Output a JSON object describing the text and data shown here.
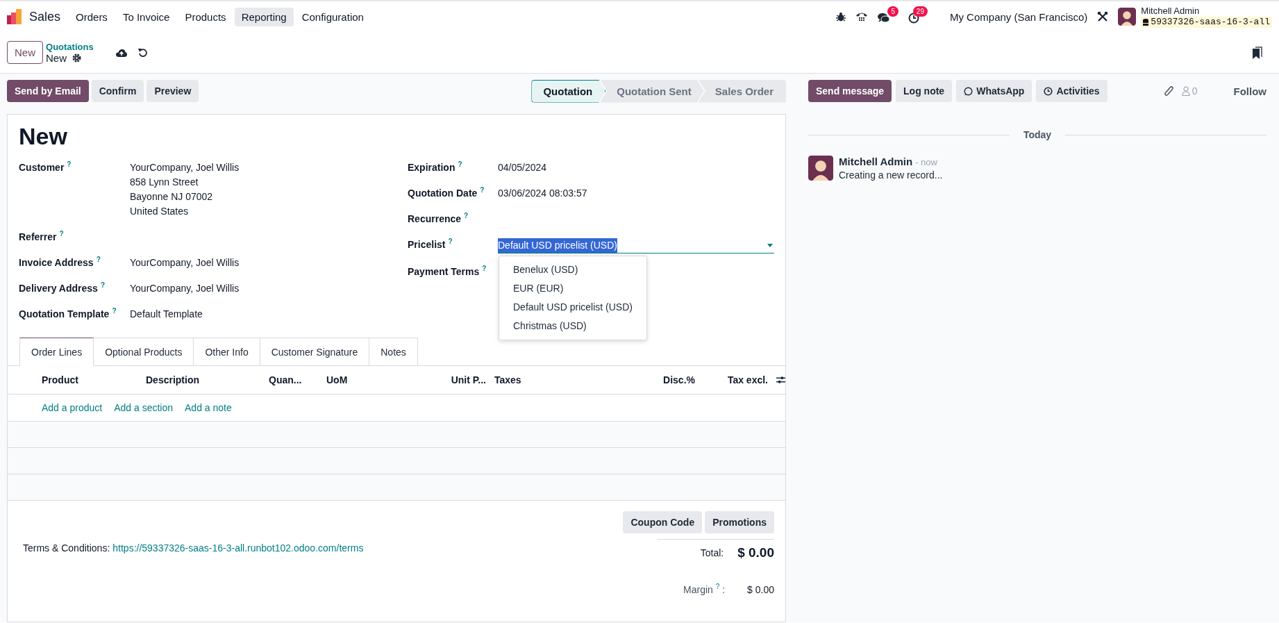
{
  "navbar": {
    "app_name": "Sales",
    "menu": [
      {
        "label": "Orders",
        "selected": false
      },
      {
        "label": "To Invoice",
        "selected": false
      },
      {
        "label": "Products",
        "selected": false
      },
      {
        "label": "Reporting",
        "selected": true
      },
      {
        "label": "Configuration",
        "selected": false
      }
    ],
    "messages_badge": "5",
    "activities_badge": "29",
    "company": "My Company (San Francisco)",
    "user_name": "Mitchell Admin",
    "database": "59337326-saas-16-3-all"
  },
  "control_panel": {
    "new_button": "New",
    "breadcrumb": "Quotations",
    "record_name": "New"
  },
  "actions": [
    {
      "label": "Send by Email",
      "kind": "primary"
    },
    {
      "label": "Confirm",
      "kind": "secondary"
    },
    {
      "label": "Preview",
      "kind": "secondary"
    }
  ],
  "stages": [
    {
      "label": "Quotation",
      "selected": true
    },
    {
      "label": "Quotation Sent",
      "selected": false
    },
    {
      "label": "Sales Order",
      "selected": false
    }
  ],
  "form": {
    "title": "New",
    "left_fields": [
      {
        "label": "Customer",
        "help": "?",
        "values": [
          "YourCompany, Joel Willis",
          "858 Lynn Street",
          "Bayonne NJ 07002",
          "United States"
        ]
      },
      {
        "label": "Referrer",
        "help": "?"
      },
      {
        "label": "Invoice Address",
        "help": "?",
        "values": [
          "YourCompany, Joel Willis"
        ]
      },
      {
        "label": "Delivery Address",
        "help": "?",
        "values": [
          "YourCompany, Joel Willis"
        ]
      },
      {
        "label": "Quotation Template",
        "help": "?",
        "values": [
          "Default Template"
        ]
      }
    ],
    "right_fields": [
      {
        "label": "Expiration",
        "help": "?",
        "kind": "text",
        "values": [
          "04/05/2024"
        ]
      },
      {
        "label": "Quotation Date",
        "help": "?",
        "kind": "text",
        "values": [
          "03/06/2024 08:03:57"
        ]
      },
      {
        "label": "Recurrence",
        "help": "?",
        "kind": "text"
      },
      {
        "label": "Pricelist",
        "help": "?",
        "kind": "select",
        "value": "Default USD pricelist (USD)",
        "text_selected": true,
        "open": true,
        "options": [
          "Benelux (USD)",
          "EUR (EUR)",
          "Default USD pricelist (USD)",
          "Christmas (USD)"
        ]
      },
      {
        "label": "Payment Terms",
        "help": "?",
        "kind": "text"
      }
    ],
    "tabs": [
      {
        "label": "Order Lines",
        "selected": true
      },
      {
        "label": "Optional Products",
        "selected": false
      },
      {
        "label": "Other Info",
        "selected": false
      },
      {
        "label": "Customer Signature",
        "selected": false
      },
      {
        "label": "Notes",
        "selected": false
      }
    ],
    "table": {
      "columns": [
        "Product",
        "Description",
        "Quan...",
        "UoM",
        "Unit P...",
        "Taxes",
        "Disc.%",
        "Tax excl."
      ],
      "add_links": [
        "Add a product",
        "Add a section",
        "Add a note"
      ]
    },
    "footer_buttons": [
      "Coupon Code",
      "Promotions"
    ],
    "terms_label": "Terms & Conditions:",
    "terms_link": "https://59337326-saas-16-3-all.runbot102.odoo.com/terms",
    "total_label": "Total:",
    "total_value": "$ 0.00",
    "margin_label": "Margin",
    "margin_help": "?",
    "margin_colon": ":",
    "margin_value": "$ 0.00"
  },
  "chatter": {
    "buttons": [
      {
        "label": "Send message",
        "kind": "primary"
      },
      {
        "label": "Log note",
        "kind": "secondary"
      },
      {
        "label": "WhatsApp",
        "kind": "whatsapp"
      },
      {
        "label": "Activities",
        "kind": "activities"
      }
    ],
    "followers_count": "0",
    "follow": "Follow",
    "separator": "Today",
    "messages": [
      {
        "author": "Mitchell Admin",
        "time": "- now",
        "body": "Creating a new record..."
      }
    ]
  }
}
